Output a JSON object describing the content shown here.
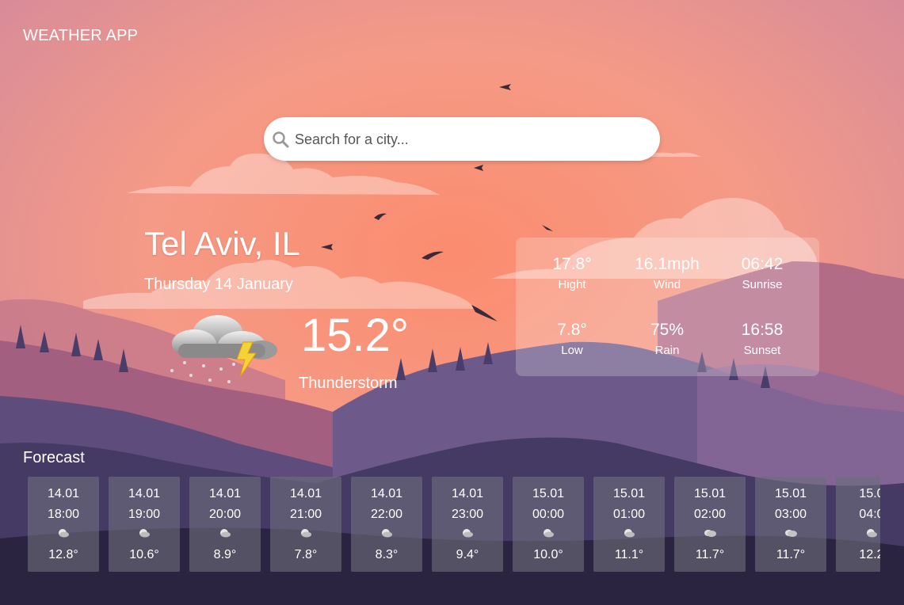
{
  "app": {
    "title": "WEATHER APP"
  },
  "search": {
    "placeholder": "Search for a city...",
    "value": ""
  },
  "current": {
    "city": "Tel Aviv, IL",
    "date": "Thursday 14 January",
    "temperature": "15.2°",
    "condition": "Thunderstorm",
    "icon": "thunderstorm-icon"
  },
  "details": {
    "high": {
      "value": "17.8°",
      "label": "Hight"
    },
    "wind": {
      "value": "16.1mph",
      "label": "Wind"
    },
    "sunrise": {
      "value": "06:42",
      "label": "Sunrise"
    },
    "low": {
      "value": "7.8°",
      "label": "Low"
    },
    "rain": {
      "value": "75%",
      "label": "Rain"
    },
    "sunset": {
      "value": "16:58",
      "label": "Sunset"
    }
  },
  "forecast": {
    "title": "Forecast",
    "items": [
      {
        "date": "14.01",
        "time": "18:00",
        "temp": "12.8°",
        "icon": "moon-cloud-icon"
      },
      {
        "date": "14.01",
        "time": "19:00",
        "temp": "10.6°",
        "icon": "moon-cloud-icon"
      },
      {
        "date": "14.01",
        "time": "20:00",
        "temp": "8.9°",
        "icon": "moon-cloud-icon"
      },
      {
        "date": "14.01",
        "time": "21:00",
        "temp": "7.8°",
        "icon": "moon-cloud-icon"
      },
      {
        "date": "14.01",
        "time": "22:00",
        "temp": "8.3°",
        "icon": "moon-cloud-icon"
      },
      {
        "date": "14.01",
        "time": "23:00",
        "temp": "9.4°",
        "icon": "moon-cloud-icon"
      },
      {
        "date": "15.01",
        "time": "00:00",
        "temp": "10.0°",
        "icon": "moon-cloud-icon"
      },
      {
        "date": "15.01",
        "time": "01:00",
        "temp": "11.1°",
        "icon": "moon-cloud-icon"
      },
      {
        "date": "15.01",
        "time": "02:00",
        "temp": "11.7°",
        "icon": "cloud-icon"
      },
      {
        "date": "15.01",
        "time": "03:00",
        "temp": "11.7°",
        "icon": "cloud-icon"
      },
      {
        "date": "15.0",
        "time": "04:0",
        "temp": "12.2",
        "icon": "moon-cloud-icon"
      }
    ]
  },
  "colors": {
    "sky_top": "#d68a9e",
    "sky_mid": "#f79a84",
    "sky_low": "#fb8e72",
    "mountains_far": "#b36c86",
    "mountains_mid": "#6e5a8a",
    "mountains_near": "#453a64",
    "ground": "#2a2440"
  }
}
